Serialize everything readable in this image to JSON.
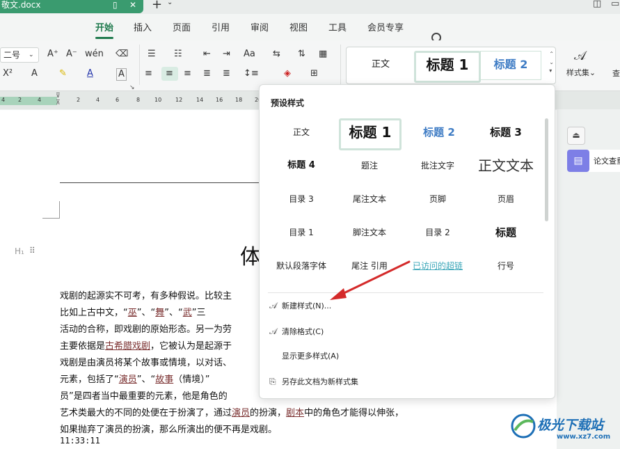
{
  "titlebar": {
    "doc_name": "敬文.docx",
    "new_tab": "+",
    "new_tab_menu": "⌄"
  },
  "menu": {
    "items": [
      "开始",
      "插入",
      "页面",
      "引用",
      "审阅",
      "视图",
      "工具",
      "会员专享"
    ]
  },
  "ribbon": {
    "font_size": "二号",
    "styles_gallery": {
      "normal": "正文",
      "heading1": "标题 1",
      "heading2": "标题 2"
    },
    "style_set": "样式集",
    "cut_off": "查"
  },
  "ruler": {
    "numbers": [
      "4",
      "2",
      "4",
      "2",
      "4",
      "6",
      "8",
      "10",
      "12",
      "14",
      "16",
      "18",
      "20"
    ]
  },
  "popup": {
    "title": "预设样式",
    "styles": [
      [
        "正文",
        "标题 1",
        "标题 2",
        "标题 3"
      ],
      [
        "标题 4",
        "题注",
        "批注文字",
        "正文文本"
      ],
      [
        "目录 3",
        "尾注文本",
        "页脚",
        "页眉"
      ],
      [
        "目录 1",
        "脚注文本",
        "目录 2",
        "标题"
      ],
      [
        "默认段落字体",
        "尾注 引用",
        "已访问的超链",
        "行号"
      ]
    ],
    "actions": [
      "新建样式(N)...",
      "清除格式(C)",
      "显示更多样式(A)",
      "另存此文档为新样式集"
    ]
  },
  "document": {
    "title": "体",
    "lines": [
      [
        "戏剧的起源实不可考，有多种假说。比较主"
      ],
      [
        "比如上古中文，“",
        {
          "u": "巫"
        },
        "”、“",
        {
          "u": "舞"
        },
        "”、“",
        {
          "u": "武"
        },
        "”三"
      ],
      [
        "活动的合称，即戏剧的原始形态。另一为劳"
      ],
      [
        "主要依据是",
        {
          "u": "古希腊戏剧"
        },
        "，它被认为是起源于"
      ],
      [
        "戏剧是由演员将某个故事或情境，以对话、"
      ],
      [
        "元素，包括了“",
        {
          "u": "演员"
        },
        "”、“",
        {
          "u": "故事"
        },
        "（情境）”"
      ],
      [
        "员”是四者当中最重要的元素，他是角色的"
      ],
      [
        "艺术类最大的不同的处便在于扮演了，通过",
        {
          "u": "演员"
        },
        "的扮演，",
        {
          "u": "剧本"
        },
        "中的角色才能得以伸张，"
      ],
      [
        "如果抛弃了演员的扮演，那么所演出的便不再是戏剧。"
      ]
    ],
    "time": "11:33:11"
  },
  "sidebar": {
    "paper_check": "论文查重"
  },
  "watermark": {
    "text": "极光下载站",
    "url": "www.xz7.com"
  },
  "colors": {
    "accent": "#1f7a4d",
    "tab_green": "#3a9b6f",
    "heading2_blue": "#3d7bc4",
    "arrow_red": "#d42a2a",
    "purple": "#7d7fe6"
  }
}
